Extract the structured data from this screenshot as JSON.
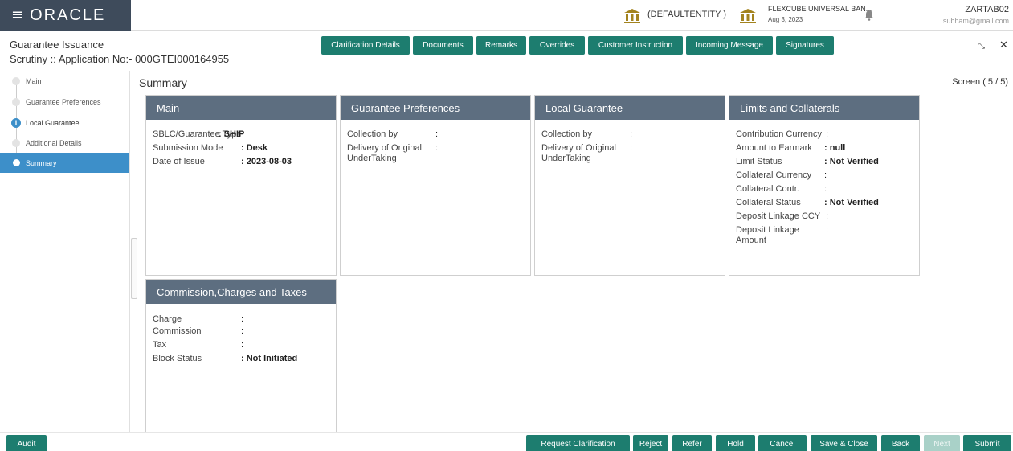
{
  "header": {
    "logo": "ORACLE",
    "entity": "(DEFAULTENTITY )",
    "branch": "FLEXCUBE UNIVERSAL BAN...",
    "branch_date": "Aug 3, 2023",
    "user": "ZARTAB02",
    "email": "subham@gmail.com"
  },
  "page": {
    "title": "Guarantee Issuance",
    "subtitle": "Scrutiny :: Application No:- 000GTEI000164955",
    "summary_title": "Summary",
    "screen_indicator": "Screen ( 5 / 5)"
  },
  "toolbar": [
    "Clarification Details",
    "Documents",
    "Remarks",
    "Overrides",
    "Customer Instruction",
    "Incoming Message",
    "Signatures"
  ],
  "steps": [
    {
      "label": "Main"
    },
    {
      "label": "Guarantee Preferences"
    },
    {
      "label": "Local Guarantee"
    },
    {
      "label": "Additional Details"
    },
    {
      "label": "Summary"
    }
  ],
  "cards": {
    "main": {
      "title": "Main",
      "rows": [
        {
          "k": "SBLC/Guarantee Type",
          "v": ": SHIP"
        },
        {
          "k": "Submission Mode",
          "v": ": Desk"
        },
        {
          "k": "Date of Issue",
          "v": ": 2023-08-03"
        }
      ]
    },
    "prefs": {
      "title": "Guarantee Preferences",
      "rows": [
        {
          "k": "Collection by",
          "v": ":"
        },
        {
          "k": "Delivery of Original",
          "k2": "UnderTaking",
          "v": ":"
        }
      ]
    },
    "local": {
      "title": "Local Guarantee",
      "rows": [
        {
          "k": "Collection by",
          "v": ":"
        },
        {
          "k": "Delivery of Original",
          "k2": "UnderTaking",
          "v": ":"
        }
      ]
    },
    "limits": {
      "title": "Limits and Collaterals",
      "rows": [
        {
          "k": "Contribution Currency",
          "v": ":"
        },
        {
          "k": "Amount to Earmark",
          "v": ": null"
        },
        {
          "k": "Limit Status",
          "v": ": Not Verified"
        },
        {
          "k": "Collateral Currency",
          "v": ":"
        },
        {
          "k": "Collateral Contr.",
          "v": ":"
        },
        {
          "k": "Collateral Status",
          "v": ": Not Verified"
        },
        {
          "k": "Deposit Linkage CCY",
          "v": ":"
        },
        {
          "k": "Deposit Linkage",
          "k2": "Amount",
          "v": ":"
        }
      ]
    },
    "charges": {
      "title": "Commission,Charges and Taxes",
      "rows": [
        {
          "k": "Charge",
          "v": ":"
        },
        {
          "k": "Commission",
          "v": ":"
        },
        {
          "k": "Tax",
          "v": ":"
        },
        {
          "k": "Block Status",
          "v": ": Not Initiated"
        }
      ]
    }
  },
  "footer": {
    "audit": "Audit",
    "request_clarification": "Request Clarification",
    "reject": "Reject",
    "refer": "Refer",
    "hold": "Hold",
    "cancel": "Cancel",
    "save_close": "Save & Close",
    "back": "Back",
    "next": "Next",
    "submit": "Submit"
  },
  "colors": {
    "accent": "#1d7d6f",
    "card_header": "#5d6e80",
    "logo_bg": "#3e4b5b",
    "active_step": "#3d8fc9"
  }
}
